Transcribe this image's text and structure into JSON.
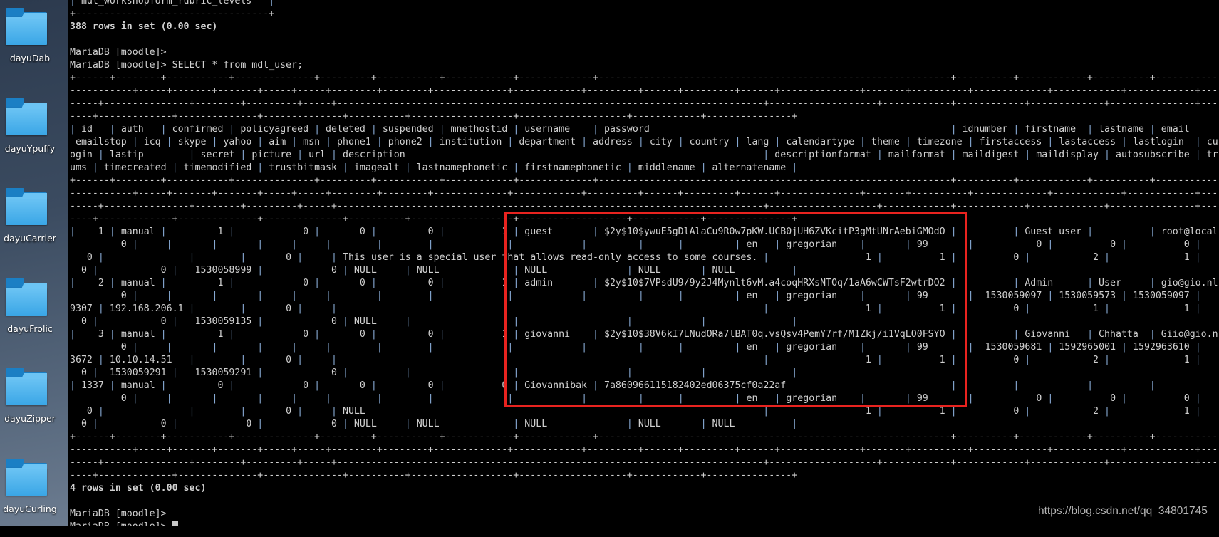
{
  "desktop": {
    "icons": [
      {
        "label": "dayuDab",
        "icon": "folder-icon"
      },
      {
        "label": "dayuYpuffy",
        "icon": "folder-icon"
      },
      {
        "label": "dayuCarrier",
        "icon": "folder-icon"
      },
      {
        "label": "dayuFrolic",
        "icon": "folder-icon"
      },
      {
        "label": "dayuZipper",
        "icon": "folder-icon"
      },
      {
        "label": "dayuCurling",
        "icon": "folder-icon"
      }
    ]
  },
  "terminal": {
    "previous_output": {
      "table_row": "| mdl_workshopform_rubric_levels   |",
      "border": "+----------------------------------+",
      "summary": "388 rows in set (0.00 sec)"
    },
    "prompts": [
      "MariaDB [moodle]>",
      "MariaDB [moodle]> SELECT * from mdl_user;"
    ],
    "query_result": {
      "header_lines": [
        "| id   | auth   | confirmed | policyagreed | deleted | suspended | mnethostid | username    | password                                                     | idnumber | firstname  | lastname | email",
        " emailstop | icq | skype | yahoo | aim | msn | phone1 | phone2 | institution | department | address | city | country | lang | calendartype | theme | timezone | firstaccess | lastaccess | lastlogin  | cu",
        "ogin | lastip        | secret | picture | url | description                                                               | descriptionformat | mailformat | maildigest | maildisplay | autosubscribe | tr",
        "ums | timecreated | timemodified | trustbitmask | imagealt | lastnamephonetic | firstnamephonetic | middlename | alternatename |"
      ],
      "rows": [
        {
          "id": "1",
          "username": "guest",
          "lines": [
            "|    1 | manual |         1 |            0 |       0 |         0 |          1 | guest       | $2y$10$ywuE5gDlAlaCu9R0w7pKW.UCB0jUH6ZVKcitP3gMtUNrAebiGMOdO |          | Guest user |          | root@local",
            "         0 |     |       |       |     |     |        |        |             |            |         |      |         | en   | gregorian    |       | 99       |           0 |          0 |          0 |",
            "   0 |               |        |       0 |     | This user is a special user that allows read-only access to some courses. |                 1 |          1 |          0 |           2 |             1 |",
            "  0 |           0 |   1530058999 |            0 | NULL     | NULL             | NULL              | NULL       | NULL          |"
          ]
        },
        {
          "id": "2",
          "username": "admin",
          "lines": [
            "|    2 | manual |         1 |            0 |       0 |         0 |          1 | admin       | $2y$10$7VPsdU9/9y2J4Mynlt6vM.a4coqHRXsNTOq/1aA6wCWTsF2wtrDO2 |          | Admin      | User     | gio@gio.nl",
            "         0 |     |       |       |     |     |        |        |             |            |         |      |         | en   | gregorian    |       | 99       |  1530059097 | 1530059573 | 1530059097 |",
            "9307 | 192.168.206.1 |        |       0 |     |                                                                           |                 1 |          1 |          0 |           1 |             1 |",
            "  0 |           0 |   1530059135 |            0 | NULL     |                  |                   |            |               |"
          ]
        },
        {
          "id": "3",
          "username": "giovanni",
          "lines": [
            "|    3 | manual |         1 |            0 |       0 |         0 |          1 | giovanni    | $2y$10$38V6kI7LNudORa7lBAT0q.vsQsv4PemY7rf/M1Zkj/i1VqLO0FSYO |          | Giovanni   | Chhatta  | Giio@gio.n",
            "         0 |     |       |       |     |     |        |        |             |            |         |      |         | en   | gregorian    |       | 99       |  1530059681 | 1592965001 | 1592963610 |",
            "3672 | 10.10.14.51   |        |       0 |     |                                                                           |                 1 |          1 |          0 |           2 |             1 |",
            "  0 |  1530059291 |   1530059291 |            0 |          |                  |                   |            |               |"
          ]
        },
        {
          "id": "1337",
          "username": "Giovannibak",
          "lines": [
            "| 1337 | manual |         0 |            0 |       0 |         0 |          0 | Giovannibak | 7a860966115182402ed06375cf0a22af                             |          |            |          |",
            "         0 |     |       |       |     |     |        |        |             |            |         |      |         | en   | gregorian    |       | 99       |           0 |          0 |          0 |",
            "   0 |               |        |       0 |     | NULL                                                                      |                 1 |          1 |          0 |           2 |             1 |",
            "  0 |           0 |            0 |            0 | NULL     | NULL             | NULL              | NULL       | NULL          |"
          ]
        }
      ],
      "summary": "4 rows in set (0.00 sec)"
    },
    "final_prompts": [
      "MariaDB [moodle]>",
      "MariaDB [moodle]> "
    ]
  },
  "annotation": {
    "color": "#e8231f"
  },
  "watermark": "https://blog.csdn.net/qq_34801745"
}
